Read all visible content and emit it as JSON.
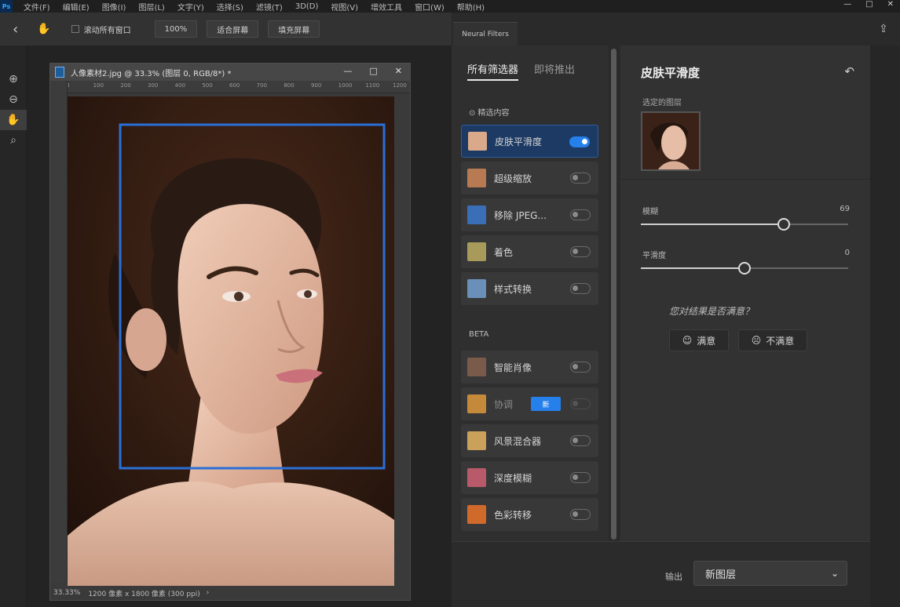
{
  "menubar": {
    "logo": "Ps",
    "items": [
      "文件(F)",
      "编辑(E)",
      "图像(I)",
      "图层(L)",
      "文字(Y)",
      "选择(S)",
      "滤镜(T)",
      "3D(D)",
      "视图(V)",
      "增效工具",
      "窗口(W)",
      "帮助(H)"
    ],
    "controls": [
      "—",
      "□",
      "✕"
    ]
  },
  "options_bar": {
    "back_icon": "chevron-left-icon",
    "hand_icon": "hand-icon",
    "scroll_all_label": "滚动所有窗口",
    "zoom_100_label": "100%",
    "fit_screen_label": "适合屏幕",
    "fill_screen_label": "填充屏幕"
  },
  "toolbar": {
    "tools": [
      {
        "name": "zoom-in-icon",
        "glyph": "⊕"
      },
      {
        "name": "zoom-out-icon",
        "glyph": "⊖"
      },
      {
        "name": "hand-tool-icon",
        "glyph": "✋"
      },
      {
        "name": "search-icon",
        "glyph": "⌕"
      }
    ]
  },
  "document": {
    "tab_title": "人像素材2.jpg @ 33.3% (图层 0, RGB/8*) *",
    "tab_controls": [
      "—",
      "□",
      "✕"
    ],
    "ruler_ticks": [
      "0",
      "100",
      "200",
      "300",
      "400",
      "500",
      "600",
      "700",
      "800",
      "900",
      "1000",
      "1100",
      "1200"
    ],
    "status_zoom": "33.33%",
    "status_info": "1200 像素 x 1800 像素 (300 ppi)",
    "status_arrow": "›",
    "selection_color": "#2a6fd6"
  },
  "neural_filters": {
    "tab_label": "Neural Filters",
    "export_icon": "export-icon",
    "tabs": {
      "all_filters": "所有筛选器",
      "waitlist": "即将推出"
    },
    "section_featured": "⊙ 精选内容",
    "section_beta": "BETA",
    "featured": [
      {
        "label": "皮肤平滑度",
        "on": true,
        "selected": true,
        "thumb": "#d9a98a"
      },
      {
        "label": "超级缩放",
        "on": false,
        "selected": false,
        "thumb": "#b87a52"
      },
      {
        "label": "移除 JPEG...",
        "on": false,
        "selected": false,
        "thumb": "#3a6fb8"
      },
      {
        "label": "着色",
        "on": false,
        "selected": false,
        "thumb": "#a89a5a"
      },
      {
        "label": "样式转换",
        "on": false,
        "selected": false,
        "thumb": "#6a8fb8"
      }
    ],
    "beta": [
      {
        "label": "智能肖像",
        "on": false,
        "muted": false,
        "thumb": "#7a5a4a"
      },
      {
        "label": "协调",
        "on": false,
        "muted": true,
        "badge": "新",
        "thumb": "#c48a3a"
      },
      {
        "label": "风景混合器",
        "on": false,
        "muted": false,
        "thumb": "#c9a15a"
      },
      {
        "label": "深度模糊",
        "on": false,
        "muted": false,
        "thumb": "#b85a6a"
      },
      {
        "label": "色彩转移",
        "on": false,
        "muted": false,
        "thumb": "#d06a2a"
      }
    ]
  },
  "settings": {
    "title": "皮肤平滑度",
    "reset_icon": "reset-icon",
    "selected_layer_label": "选定的图层",
    "blur": {
      "label": "模糊",
      "value": "69",
      "fraction": 0.69
    },
    "smoothness": {
      "label": "平滑度",
      "value": "0",
      "fraction": 0.5
    },
    "feedback_question": "您对结果是否满意？",
    "satisfied_label": "满意",
    "unsatisfied_label": "不满意"
  },
  "output": {
    "label": "输出",
    "value": "新图层"
  }
}
